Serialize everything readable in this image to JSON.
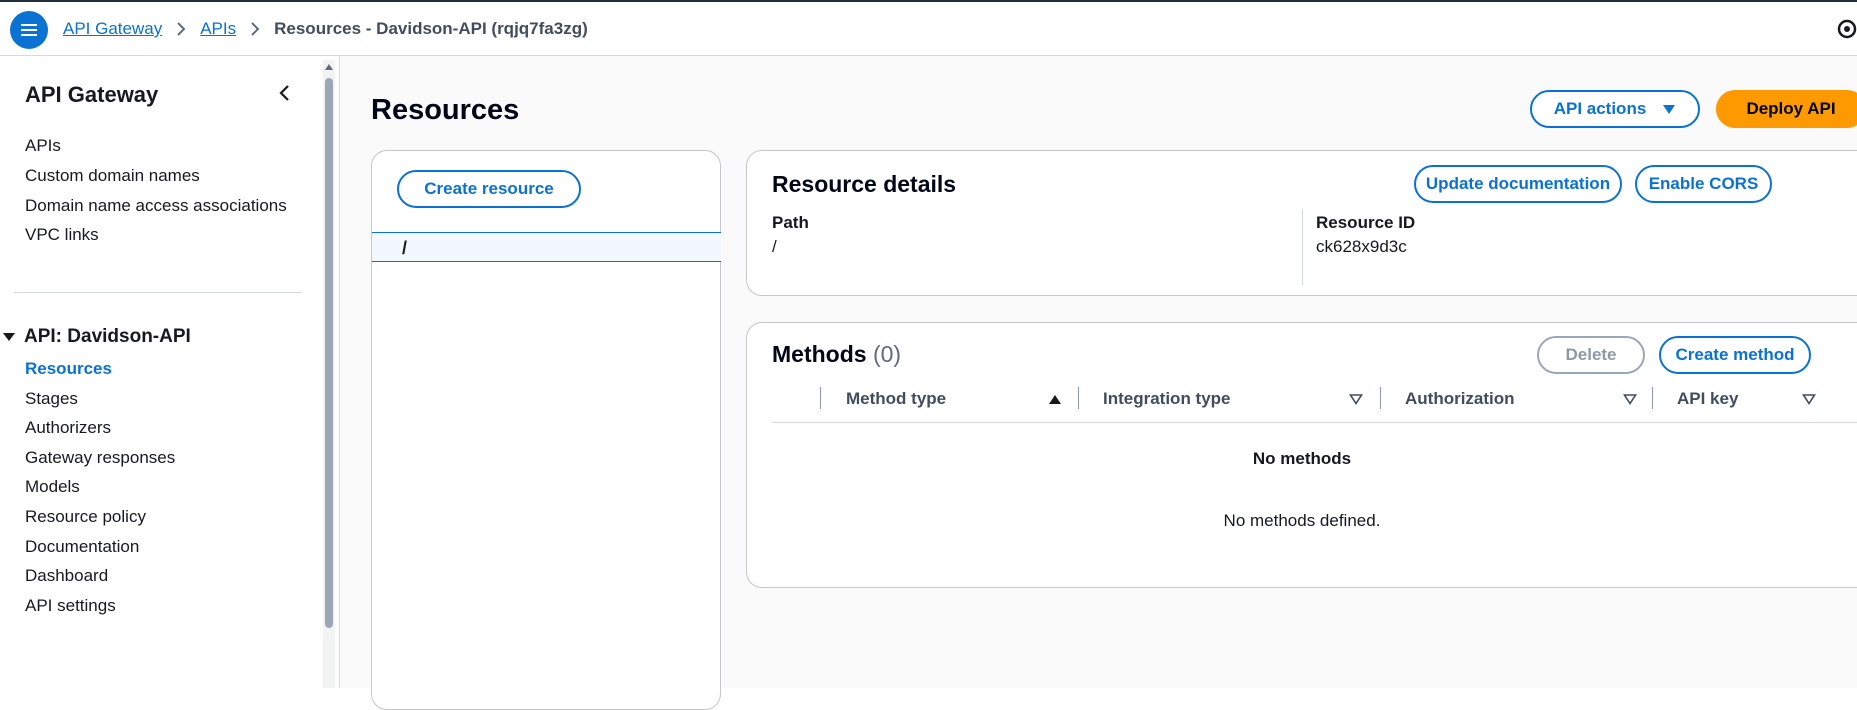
{
  "breadcrumb": {
    "items": [
      "API Gateway",
      "APIs"
    ],
    "current": "Resources - Davidson-API (rqjq7fa3zg)"
  },
  "sidebar": {
    "title": "API Gateway",
    "items": [
      "APIs",
      "Custom domain names",
      "Domain name access associations",
      "VPC links"
    ],
    "section": "API: Davidson-API",
    "section_items": [
      "Resources",
      "Stages",
      "Authorizers",
      "Gateway responses",
      "Models",
      "Resource policy",
      "Documentation",
      "Dashboard",
      "API settings"
    ],
    "active_item": "Resources"
  },
  "main": {
    "title": "Resources",
    "api_actions_label": "API actions",
    "deploy_label": "Deploy API",
    "tree": {
      "create_resource_label": "Create resource",
      "selected_resource": "/",
      "cursor_glyph": "I"
    },
    "details": {
      "title": "Resource details",
      "update_doc_label": "Update documentation",
      "enable_cors_label": "Enable CORS",
      "path_label": "Path",
      "path_value": "/",
      "resource_id_label": "Resource ID",
      "resource_id_value": "ck628x9d3c"
    },
    "methods": {
      "title": "Methods",
      "count": "(0)",
      "delete_label": "Delete",
      "create_method_label": "Create method",
      "columns": [
        "Method type",
        "Integration type",
        "Authorization",
        "API key"
      ],
      "empty_title": "No methods",
      "empty_text": "No methods defined."
    }
  },
  "colors": {
    "accent": "#0972d3",
    "primary_button": "#ff9900",
    "border": "#c6c6cd"
  }
}
